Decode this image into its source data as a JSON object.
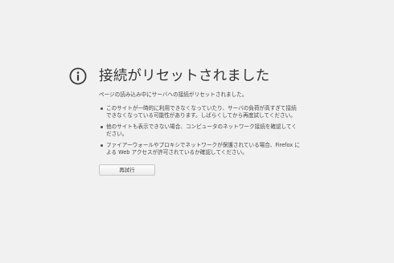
{
  "error": {
    "icon": "info-icon",
    "title": "接続がリセットされました",
    "description": "ページの読み込み中にサーバへの接続がリセットされました。",
    "advice": [
      "このサイトが一時的に利用できなくなっていたり、サーバの負荷が高すぎて接続できなくなっている可能性があります。しばらくしてから再度試してください。",
      "他のサイトも表示できない場合、コンピュータのネットワーク接続を確認してください。",
      "ファイアーウォールやプロキシでネットワークが保護されている場合、Firefox による Web アクセスが許可されているか確認してください。"
    ],
    "retry_label": "再試行"
  },
  "colors": {
    "background": "#f1f1f1",
    "text": "#333333",
    "icon": "#3a3a3a"
  }
}
